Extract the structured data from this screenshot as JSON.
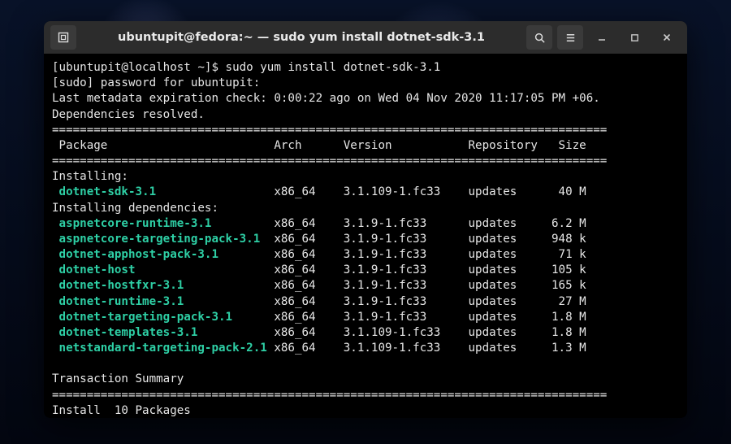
{
  "window": {
    "title": "ubuntupit@fedora:~ — sudo yum install dotnet-sdk-3.1"
  },
  "term": {
    "prompt": "[ubuntupit@localhost ~]$ sudo yum install dotnet-sdk-3.1",
    "sudo_pw": "[sudo] password for ubuntupit:",
    "meta": "Last metadata expiration check: 0:00:22 ago on Wed 04 Nov 2020 11:17:05 PM +06.",
    "dep_resolved": "Dependencies resolved.",
    "hr": "================================================================================",
    "headers": {
      "package": " Package",
      "arch": "Arch",
      "version": "Version",
      "repo": "Repository",
      "size": "Size"
    },
    "installing_hdr": "Installing:",
    "installing_deps_hdr": "Installing dependencies:",
    "rows": [
      {
        "pkg": "dotnet-sdk-3.1",
        "arch": "x86_64",
        "ver": "3.1.109-1.fc33",
        "repo": "updates",
        "size": "40 M"
      },
      {
        "pkg": "aspnetcore-runtime-3.1",
        "arch": "x86_64",
        "ver": "3.1.9-1.fc33",
        "repo": "updates",
        "size": "6.2 M"
      },
      {
        "pkg": "aspnetcore-targeting-pack-3.1",
        "arch": "x86_64",
        "ver": "3.1.9-1.fc33",
        "repo": "updates",
        "size": "948 k"
      },
      {
        "pkg": "dotnet-apphost-pack-3.1",
        "arch": "x86_64",
        "ver": "3.1.9-1.fc33",
        "repo": "updates",
        "size": "71 k"
      },
      {
        "pkg": "dotnet-host",
        "arch": "x86_64",
        "ver": "3.1.9-1.fc33",
        "repo": "updates",
        "size": "105 k"
      },
      {
        "pkg": "dotnet-hostfxr-3.1",
        "arch": "x86_64",
        "ver": "3.1.9-1.fc33",
        "repo": "updates",
        "size": "165 k"
      },
      {
        "pkg": "dotnet-runtime-3.1",
        "arch": "x86_64",
        "ver": "3.1.9-1.fc33",
        "repo": "updates",
        "size": "27 M"
      },
      {
        "pkg": "dotnet-targeting-pack-3.1",
        "arch": "x86_64",
        "ver": "3.1.9-1.fc33",
        "repo": "updates",
        "size": "1.8 M"
      },
      {
        "pkg": "dotnet-templates-3.1",
        "arch": "x86_64",
        "ver": "3.1.109-1.fc33",
        "repo": "updates",
        "size": "1.8 M"
      },
      {
        "pkg": "netstandard-targeting-pack-2.1",
        "arch": "x86_64",
        "ver": "3.1.109-1.fc33",
        "repo": "updates",
        "size": "1.3 M"
      }
    ],
    "tx_summary": "Transaction Summary",
    "install_count": "Install  10 Packages"
  }
}
